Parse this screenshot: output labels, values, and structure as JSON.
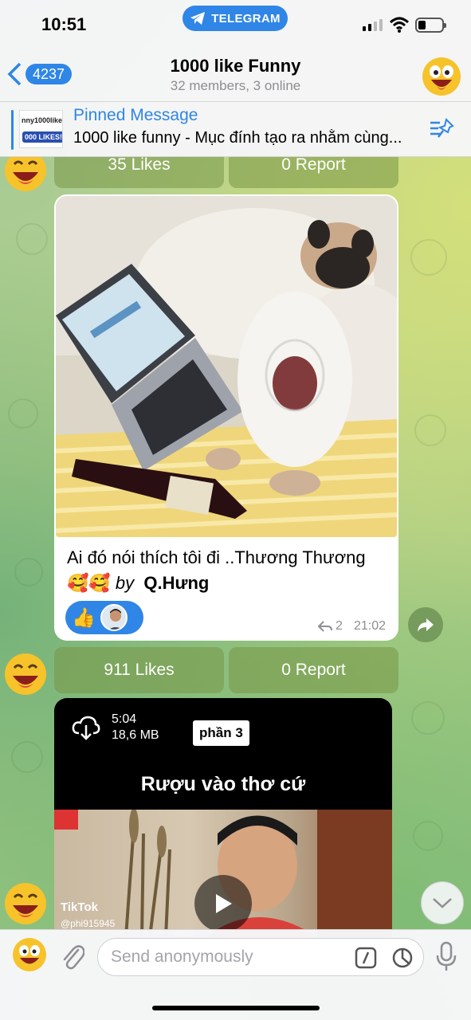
{
  "status_bar": {
    "time": "10:51",
    "app_pill": "TELEGRAM"
  },
  "header": {
    "back_count": "4237",
    "title": "1000 like Funny",
    "subtitle": "32 members, 3 online"
  },
  "pinned": {
    "label": "Pinned Message",
    "text": "1000 like funny - Mục đính tạo ra nhằm cùng...",
    "thumb_line1": "nny1000like",
    "thumb_line2": "000 LIKES!"
  },
  "messages": [
    {
      "buttons": [
        {
          "label": "35 Likes"
        },
        {
          "label": "0 Report"
        }
      ]
    },
    {
      "caption_text": "Ai đó  nói thích tôi đi ..Thương Thương ",
      "caption_emoji": "🥰🥰",
      "caption_by": "by",
      "caption_author": "Q.Hưng",
      "reaction_emoji": "👍",
      "replies": "2",
      "time": "21:02",
      "buttons": [
        {
          "label": "911 Likes"
        },
        {
          "label": "0 Report"
        }
      ]
    },
    {
      "video": {
        "duration": "5:04",
        "size": "18,6 MB",
        "tag": "phần 3",
        "title": "Rượu vào thơ cứ",
        "watermark": "TikTok",
        "watermark_user": "@phi915945"
      }
    }
  ],
  "input": {
    "placeholder": "Send anonymously"
  },
  "colors": {
    "accent": "#2f86e6",
    "button_bg": "#7f9a50"
  }
}
